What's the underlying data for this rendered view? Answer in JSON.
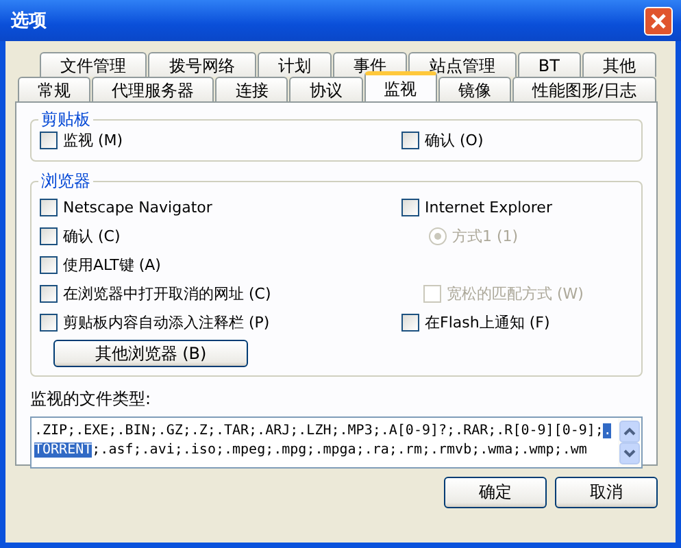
{
  "window": {
    "title": "选项"
  },
  "tab_rows": [
    [
      {
        "label": "文件管理",
        "selected": false
      },
      {
        "label": "拨号网络",
        "selected": false
      },
      {
        "label": "计划",
        "selected": false
      },
      {
        "label": "事件",
        "selected": false
      },
      {
        "label": "站点管理",
        "selected": false
      },
      {
        "label": "BT",
        "selected": false
      },
      {
        "label": "其他",
        "selected": false
      }
    ],
    [
      {
        "label": "常规",
        "selected": false
      },
      {
        "label": "代理服务器",
        "selected": false
      },
      {
        "label": "连接",
        "selected": false
      },
      {
        "label": "协议",
        "selected": false
      },
      {
        "label": "监视",
        "selected": true
      },
      {
        "label": "镜像",
        "selected": false
      },
      {
        "label": "性能图形/日志",
        "selected": false
      }
    ]
  ],
  "clipboard": {
    "title": "剪贴板",
    "left": {
      "kind": "checkbox",
      "label": "监视 (M)",
      "checked": false,
      "disabled": false
    },
    "right": {
      "kind": "checkbox",
      "label": "确认 (O)",
      "checked": false,
      "disabled": false
    }
  },
  "browser": {
    "title": "浏览器",
    "rows": [
      {
        "left": {
          "kind": "checkbox",
          "label": "Netscape Navigator",
          "checked": false,
          "disabled": false
        },
        "right": {
          "kind": "checkbox",
          "label": "Internet Explorer",
          "checked": false,
          "disabled": false
        }
      },
      {
        "left": {
          "kind": "checkbox",
          "label": "确认 (C)",
          "checked": false,
          "disabled": false
        },
        "right": {
          "kind": "radio",
          "label": "方式1 (1)",
          "selected": true,
          "disabled": true
        }
      },
      {
        "left": {
          "kind": "checkbox",
          "label": "使用ALT键 (A)",
          "checked": false,
          "disabled": false
        }
      },
      {
        "left": {
          "kind": "checkbox",
          "label": "在浏览器中打开取消的网址 (C)",
          "checked": false,
          "disabled": false
        },
        "right": {
          "kind": "checkbox",
          "label": "宽松的匹配方式 (W)",
          "checked": false,
          "disabled": true
        }
      },
      {
        "left": {
          "kind": "checkbox",
          "label": "剪贴板内容自动添入注释栏 (P)",
          "checked": false,
          "disabled": false
        },
        "right": {
          "kind": "checkbox",
          "label": "在Flash上通知 (F)",
          "checked": false,
          "disabled": false
        }
      }
    ],
    "button": "其他浏览器 (B)"
  },
  "file_types": {
    "label": "监视的文件类型:",
    "text_before": ".ZIP;.EXE;.BIN;.GZ;.Z;.TAR;.ARJ;.LZH;.MP3;.A[0-9]?;.RAR;.R[0-9][0-9];",
    "selected_text": ".TORRENT",
    "text_after": ";.asf;.avi;.iso;.mpeg;.mpg;.mpga;.ra;.rm;.rmvb;.wma;.wmp;.wm"
  },
  "buttons": [
    "确定",
    "取消"
  ]
}
